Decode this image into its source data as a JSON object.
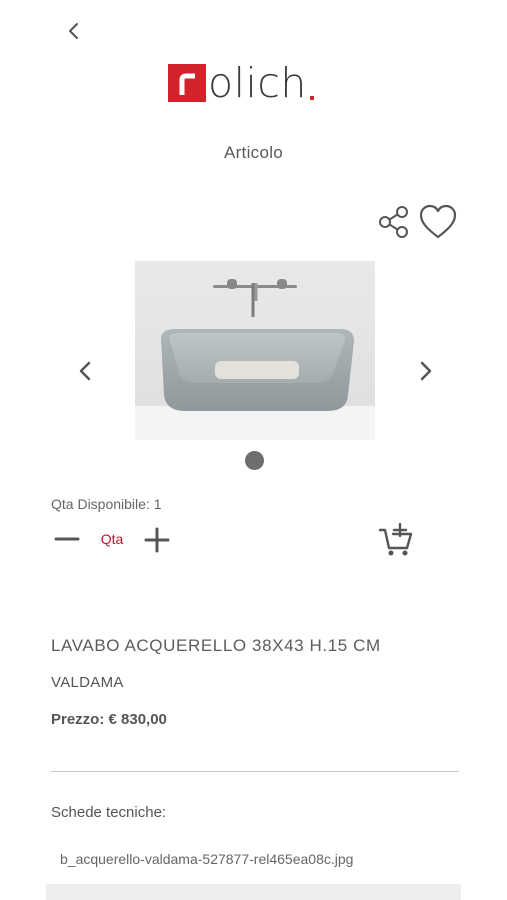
{
  "brand_logo": {
    "text": "olich",
    "accent_color": "#d2232a"
  },
  "header": {
    "title": "Articolo"
  },
  "gallery": {
    "current_index": 1,
    "image_alt": "LAVABO ACQUERELLO 38X43 H.15 CM"
  },
  "quantity": {
    "available_label": "Qta Disponibile: 1",
    "placeholder": "Qta"
  },
  "product": {
    "name": "LAVABO ACQUERELLO 38X43 H.15 CM",
    "brand": "VALDAMA",
    "price": "Prezzo: € 830,00"
  },
  "tech_sheets": {
    "label": "Schede tecniche:",
    "files": [
      "b_acquerello-valdama-527877-rel465ea08c.jpg"
    ]
  },
  "icons": {
    "back": "chevron-left-icon",
    "share": "share-icon",
    "favorite": "heart-icon",
    "prev": "chevron-left-icon",
    "next": "chevron-right-icon",
    "minus": "minus-icon",
    "plus": "plus-icon",
    "cart": "add-to-cart-icon"
  },
  "colors": {
    "accent": "#d2232a",
    "text": "#555555"
  }
}
